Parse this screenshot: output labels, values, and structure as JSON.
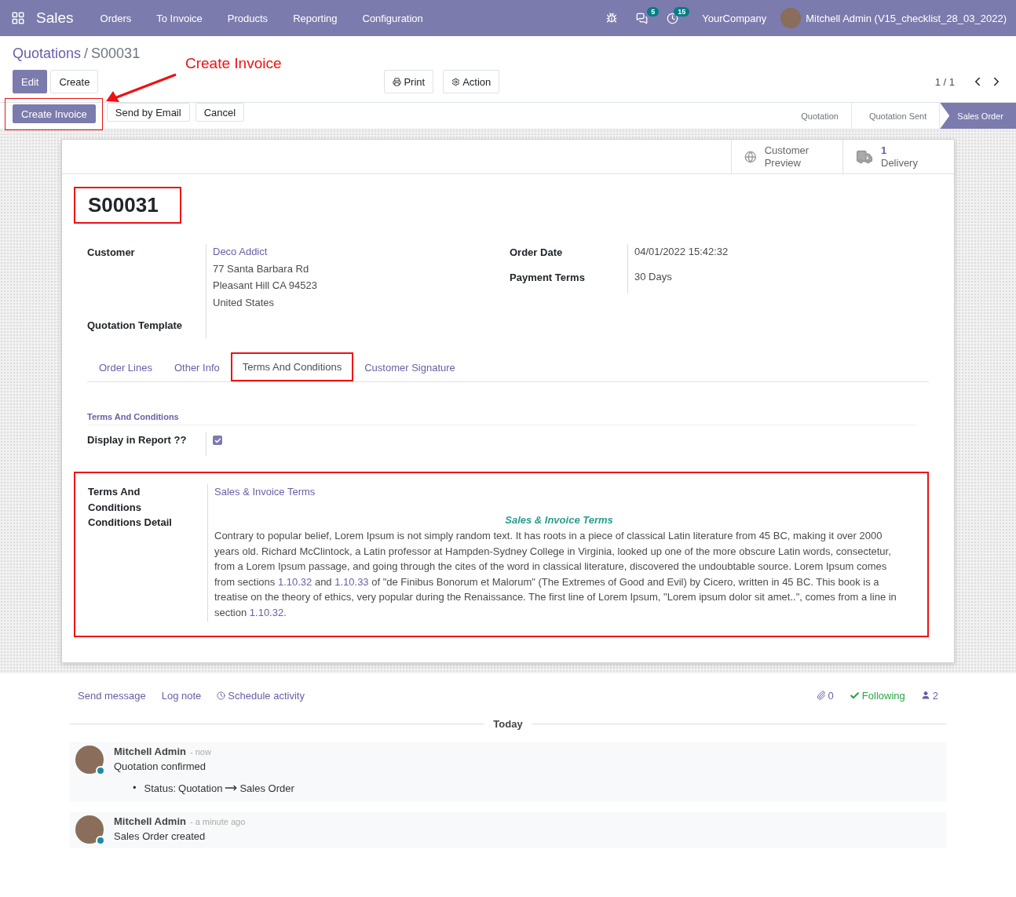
{
  "navbar": {
    "app_name": "Sales",
    "menu": [
      "Orders",
      "To Invoice",
      "Products",
      "Reporting",
      "Configuration"
    ],
    "messages_badge": "5",
    "activities_badge": "15",
    "company": "YourCompany",
    "user": "Mitchell Admin (V15_checklist_28_03_2022)"
  },
  "breadcrumb": {
    "parent": "Quotations",
    "separator": "/",
    "current": "S00031"
  },
  "callout": {
    "text": "Create Invoice"
  },
  "main_buttons": [
    {
      "label": "Edit",
      "kind": "primary"
    },
    {
      "label": "Create",
      "kind": "secondary"
    }
  ],
  "action_buttons": [
    {
      "label": "Print",
      "kind": "print"
    },
    {
      "label": "Action",
      "kind": "action"
    }
  ],
  "pager": "1 / 1",
  "status_buttons": [
    {
      "label": "Create Invoice",
      "kind": "primary",
      "highlighted": true
    },
    {
      "label": "Send by Email",
      "kind": "secondary",
      "highlighted": false
    },
    {
      "label": "Cancel",
      "kind": "secondary",
      "highlighted": false
    }
  ],
  "stages": [
    {
      "label": "Quotation",
      "selected": false
    },
    {
      "label": "Quotation Sent",
      "selected": false
    },
    {
      "label": "Sales Order",
      "selected": true
    }
  ],
  "smart_buttons": [
    {
      "kind": "globe",
      "label": "Customer Preview"
    },
    {
      "kind": "truck",
      "count": "1",
      "label": "Delivery"
    }
  ],
  "title": {
    "text": "S00031",
    "highlighted": true
  },
  "left_fields": [
    {
      "label": "Customer",
      "values": [
        {
          "text": "Deco Addict",
          "kind": "link"
        },
        {
          "text": "77 Santa Barbara Rd",
          "kind": "text"
        },
        {
          "text": "Pleasant Hill CA 94523",
          "kind": "text"
        },
        {
          "text": "United States",
          "kind": "text"
        }
      ]
    },
    {
      "label": "Quotation Template"
    }
  ],
  "right_fields": [
    {
      "label": "Order Date",
      "value": "04/01/2022 15:42:32"
    },
    {
      "label": "Payment Terms",
      "value": "30 Days"
    }
  ],
  "tabs": [
    {
      "label": "Order Lines",
      "selected": false,
      "highlighted": false
    },
    {
      "label": "Other Info",
      "selected": false,
      "highlighted": false
    },
    {
      "label": "Terms And Conditions",
      "selected": true,
      "highlighted": true
    },
    {
      "label": "Customer Signature",
      "selected": false,
      "highlighted": false
    }
  ],
  "section_title": "Terms And Conditions",
  "display_in_report": {
    "label": "Display in Report ??",
    "checked": true
  },
  "terms": {
    "highlighted": true,
    "label_lines": [
      "Terms And",
      "Conditions",
      "Conditions Detail"
    ],
    "link": "Sales & Invoice Terms",
    "heading": "Sales & Invoice Terms",
    "body": [
      {
        "kind": "text",
        "text": "Contrary to popular belief, Lorem Ipsum is not simply random text. It has roots in a piece of classical Latin literature from 45 BC, making it over 2000 years old. Richard McClintock, a Latin professor at Hampden-Sydney College in Virginia, looked up one of the more obscure Latin words, consectetur, from a Lorem Ipsum passage, and going through the cites of the word in classical literature, discovered the undoubtable source. Lorem Ipsum comes from sections "
      },
      {
        "kind": "link",
        "text": "1.10.32"
      },
      {
        "kind": "text",
        "text": " and "
      },
      {
        "kind": "link",
        "text": "1.10.33"
      },
      {
        "kind": "text",
        "text": " of \"de Finibus Bonorum et Malorum\" (The Extremes of Good and Evil) by Cicero, written in 45 BC. This book is a treatise on the theory of ethics, very popular during the Renaissance. The first line of Lorem Ipsum, \"Lorem ipsum dolor sit amet..\", comes from a line in section "
      },
      {
        "kind": "link",
        "text": "1.10.32."
      }
    ]
  },
  "chatter": {
    "actions": [
      {
        "label": "Send message",
        "kind": "plain"
      },
      {
        "label": "Log note",
        "kind": "plain"
      },
      {
        "label": "Schedule activity",
        "kind": "clock"
      }
    ],
    "attachments": "0",
    "following": "Following",
    "followers": "2",
    "divider": "Today",
    "messages": [
      {
        "author": "Mitchell Admin",
        "time": "- now",
        "body": "Quotation confirmed",
        "tracking": {
          "bullet": "•",
          "label": "Status:",
          "old": "Quotation",
          "new": "Sales Order"
        }
      },
      {
        "author": "Mitchell Admin",
        "time": "- a minute ago",
        "body": "Sales Order created"
      }
    ]
  }
}
